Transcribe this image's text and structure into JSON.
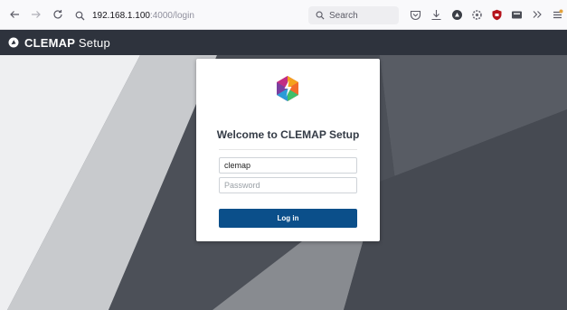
{
  "browser": {
    "url_host": "192.168.1.100",
    "url_path": ":4000/login",
    "search_label": "Search"
  },
  "header": {
    "brand_bold": "CLEMAP",
    "brand_rest": "Setup"
  },
  "login": {
    "title": "Welcome to CLEMAP Setup",
    "username_value": "clemap",
    "password_placeholder": "Password",
    "login_label": "Log in"
  },
  "colors": {
    "header_bg": "#2e333d",
    "button_bg": "#0b4f8a"
  }
}
